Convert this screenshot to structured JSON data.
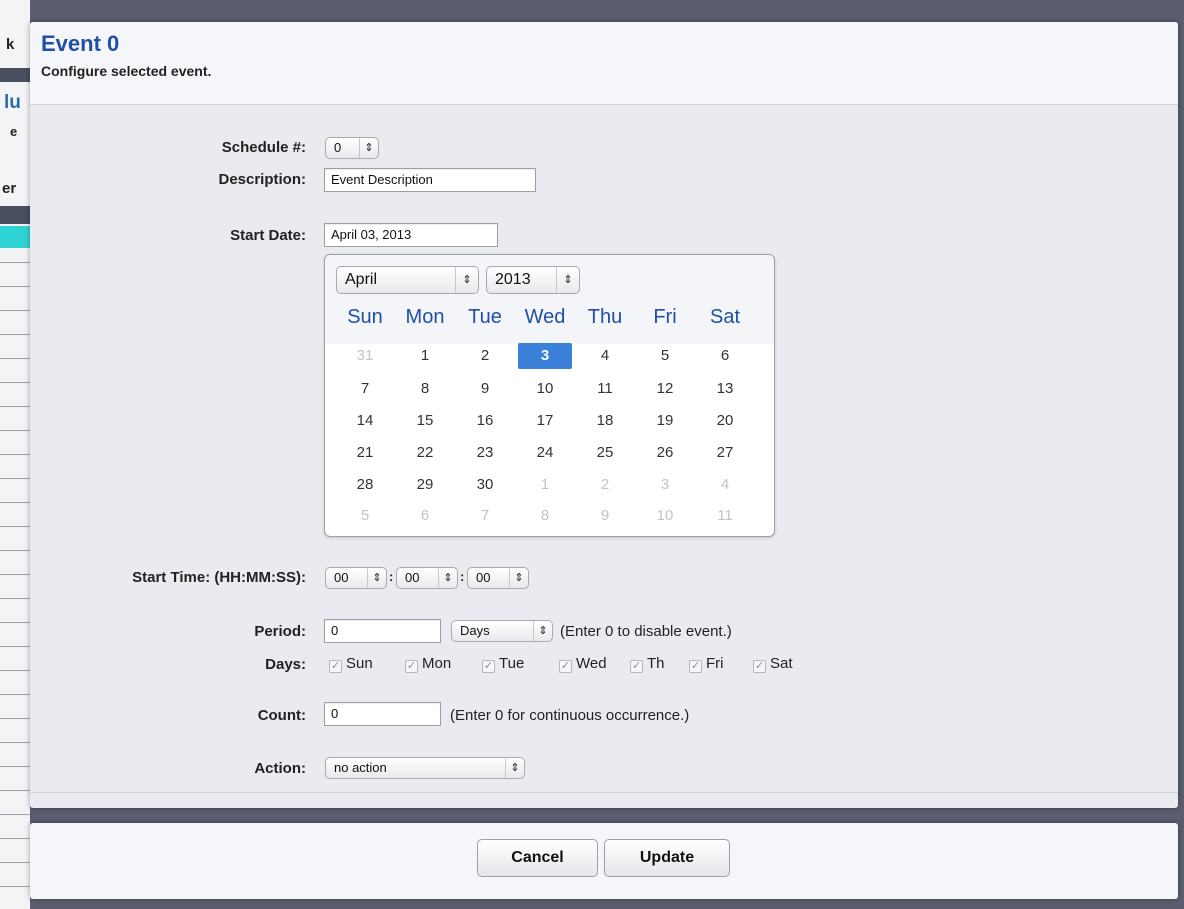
{
  "background_fragments": [
    "k",
    "lu",
    "e",
    "er"
  ],
  "dialog": {
    "title": "Event 0",
    "subtitle": "Configure selected event."
  },
  "form": {
    "schedule": {
      "label": "Schedule #:",
      "value": "0"
    },
    "description": {
      "label": "Description:",
      "value": "Event Description"
    },
    "start_date": {
      "label": "Start Date:",
      "value": "April 03, 2013"
    },
    "calendar": {
      "month": "April",
      "year": "2013",
      "weekdays": [
        "Sun",
        "Mon",
        "Tue",
        "Wed",
        "Thu",
        "Fri",
        "Sat"
      ],
      "weeks": [
        [
          "31",
          "1",
          "2",
          "3",
          "4",
          "5",
          "6"
        ],
        [
          "7",
          "8",
          "9",
          "10",
          "11",
          "12",
          "13"
        ],
        [
          "14",
          "15",
          "16",
          "17",
          "18",
          "19",
          "20"
        ],
        [
          "21",
          "22",
          "23",
          "24",
          "25",
          "26",
          "27"
        ],
        [
          "28",
          "29",
          "30",
          "1",
          "2",
          "3",
          "4"
        ],
        [
          "5",
          "6",
          "7",
          "8",
          "9",
          "10",
          "11"
        ]
      ],
      "selected_day": "3"
    },
    "start_time": {
      "label": "Start Time: (HH:MM:SS):",
      "hh": "00",
      "mm": "00",
      "ss": "00",
      "sep": ":"
    },
    "period": {
      "label": "Period:",
      "value": "0",
      "unit": "Days",
      "hint": "(Enter 0 to disable event.)"
    },
    "days": {
      "label": "Days:",
      "items": [
        {
          "label": "Sun",
          "checked": true
        },
        {
          "label": "Mon",
          "checked": true
        },
        {
          "label": "Tue",
          "checked": true
        },
        {
          "label": "Wed",
          "checked": true
        },
        {
          "label": "Th",
          "checked": true
        },
        {
          "label": "Fri",
          "checked": true
        },
        {
          "label": "Sat",
          "checked": true
        }
      ]
    },
    "count": {
      "label": "Count:",
      "value": "0",
      "hint": "(Enter 0 for continuous occurrence.)"
    },
    "action": {
      "label": "Action:",
      "value": "no action"
    }
  },
  "footer": {
    "cancel_label": "Cancel",
    "update_label": "Update"
  },
  "icons": {
    "select_arrows": "updown-arrow-icon",
    "check": "checkmark-icon"
  },
  "colors": {
    "title_blue": "#1f4fa6",
    "selected_day": "#3a7fd8",
    "muted_day": "#c2c4c8"
  }
}
